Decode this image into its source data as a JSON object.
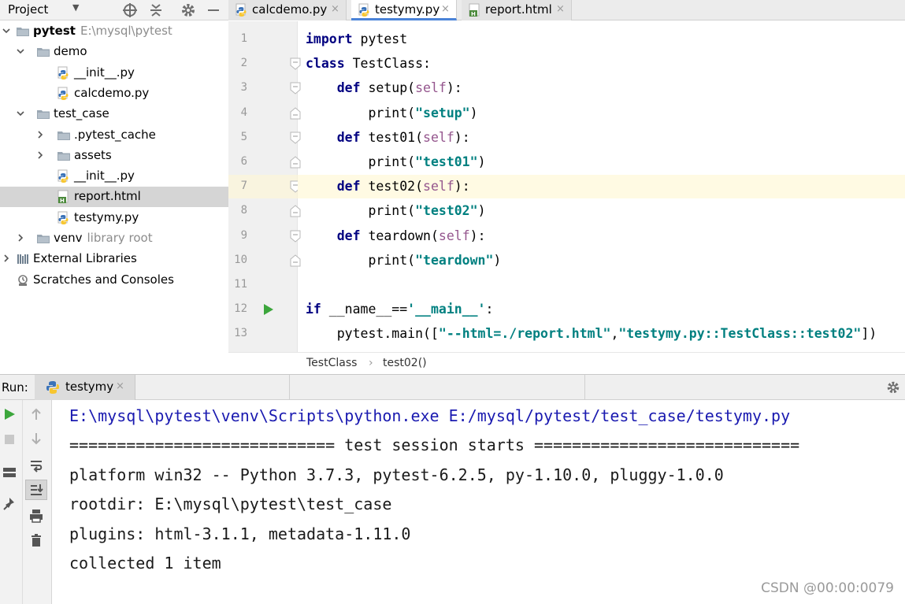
{
  "project_panel": {
    "title": "Project",
    "tree": [
      {
        "label": "pytest",
        "muted": "E:\\mysql\\pytest",
        "type": "folder",
        "depth": 0,
        "expanded": true,
        "bold": true
      },
      {
        "label": "demo",
        "type": "folder",
        "depth": 1,
        "expanded": true
      },
      {
        "label": "__init__.py",
        "type": "python",
        "depth": 2
      },
      {
        "label": "calcdemo.py",
        "type": "python",
        "depth": 2
      },
      {
        "label": "test_case",
        "type": "folder",
        "depth": 1,
        "expanded": true
      },
      {
        "label": ".pytest_cache",
        "type": "folder",
        "depth": 2,
        "collapsed": true
      },
      {
        "label": "assets",
        "type": "folder",
        "depth": 2,
        "collapsed": true
      },
      {
        "label": "__init__.py",
        "type": "python",
        "depth": 2
      },
      {
        "label": "report.html",
        "type": "html",
        "depth": 2,
        "selected": true
      },
      {
        "label": "testymy.py",
        "type": "python",
        "depth": 2
      },
      {
        "label": "venv",
        "muted": "library root",
        "type": "folder",
        "depth": 1,
        "collapsed": true
      },
      {
        "label": "External Libraries",
        "type": "library",
        "depth": 0,
        "collapsed": true
      },
      {
        "label": "Scratches and Consoles",
        "type": "scratch",
        "depth": 0
      }
    ]
  },
  "editor_tabs": [
    {
      "label": "calcdemo.py",
      "type": "python",
      "close": "×"
    },
    {
      "label": "testymy.py",
      "type": "python",
      "active": true,
      "close": "×"
    },
    {
      "label": "report.html",
      "type": "html",
      "close": "×"
    }
  ],
  "code": {
    "highlighted_line": 7,
    "lines": [
      [
        {
          "t": "import",
          "c": "kw"
        },
        {
          "t": " pytest"
        }
      ],
      [
        {
          "t": "class",
          "c": "kw"
        },
        {
          "t": " TestClass:"
        }
      ],
      [
        {
          "t": "    "
        },
        {
          "t": "def",
          "c": "kw"
        },
        {
          "t": " setup("
        },
        {
          "t": "self",
          "c": "slf"
        },
        {
          "t": "):"
        }
      ],
      [
        {
          "t": "        print("
        },
        {
          "t": "\"setup\"",
          "c": "str"
        },
        {
          "t": ")"
        }
      ],
      [
        {
          "t": "    "
        },
        {
          "t": "def",
          "c": "kw"
        },
        {
          "t": " test01("
        },
        {
          "t": "self",
          "c": "slf"
        },
        {
          "t": "):"
        }
      ],
      [
        {
          "t": "        print("
        },
        {
          "t": "\"test01\"",
          "c": "str"
        },
        {
          "t": ")"
        }
      ],
      [
        {
          "t": "    "
        },
        {
          "t": "def",
          "c": "kw"
        },
        {
          "t": " test02("
        },
        {
          "t": "self",
          "c": "slf"
        },
        {
          "t": "):"
        }
      ],
      [
        {
          "t": "        print("
        },
        {
          "t": "\"test02\"",
          "c": "str"
        },
        {
          "t": ")"
        }
      ],
      [
        {
          "t": "    "
        },
        {
          "t": "def",
          "c": "kw"
        },
        {
          "t": " teardown("
        },
        {
          "t": "self",
          "c": "slf"
        },
        {
          "t": "):"
        }
      ],
      [
        {
          "t": "        print("
        },
        {
          "t": "\"teardown\"",
          "c": "str"
        },
        {
          "t": ")"
        }
      ],
      [],
      [
        {
          "t": "if",
          "c": "kw"
        },
        {
          "t": " __name__=="
        },
        {
          "t": "'__main__'",
          "c": "str"
        },
        {
          "t": ":"
        }
      ],
      [
        {
          "t": "    pytest.main(["
        },
        {
          "t": "\"--html=./report.html\"",
          "c": "str"
        },
        {
          "t": ","
        },
        {
          "t": "\"testymy.py::TestClass::test02\"",
          "c": "str"
        },
        {
          "t": "])"
        }
      ]
    ]
  },
  "breadcrumb": {
    "items": [
      "TestClass",
      "test02()"
    ],
    "separator": "›"
  },
  "run_panel": {
    "label": "Run:",
    "tab": "testymy",
    "tab_close": "×",
    "output": [
      "E:\\mysql\\pytest\\venv\\Scripts\\python.exe E:/mysql/pytest/test_case/testymy.py",
      "============================ test session starts ============================",
      "platform win32 -- Python 3.7.3, pytest-6.2.5, py-1.10.0, pluggy-1.0.0",
      "rootdir: E:\\mysql\\pytest\\test_case",
      "plugins: html-3.1.1, metadata-1.11.0",
      "collected 1 item"
    ]
  },
  "watermark": "CSDN @00:00:0079",
  "colors": {
    "accent": "#4a83d8",
    "run_green": "#3ca63c",
    "selection": "#d5d5d5",
    "current_line": "#fffae3"
  }
}
